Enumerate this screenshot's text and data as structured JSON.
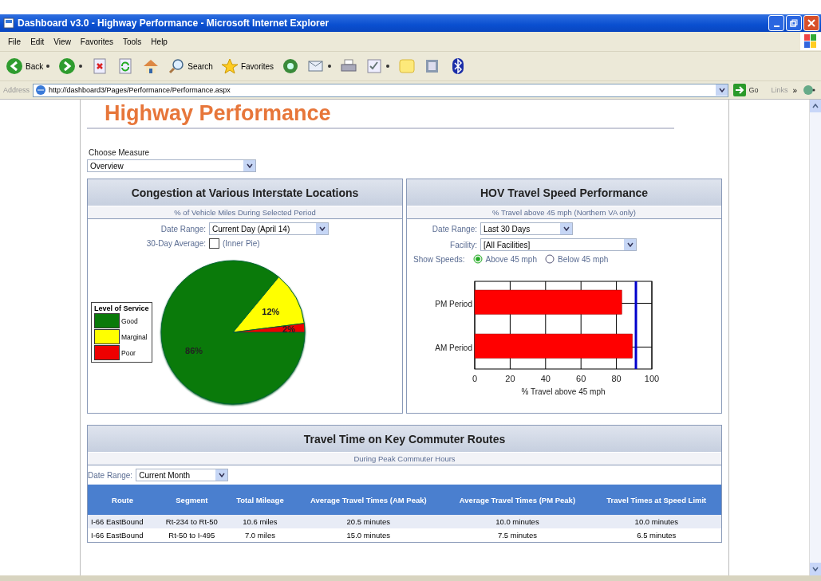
{
  "window": {
    "title": "Dashboard v3.0 - Highway Performance - Microsoft Internet Explorer"
  },
  "menu": [
    "File",
    "Edit",
    "View",
    "Favorites",
    "Tools",
    "Help"
  ],
  "toolbar": [
    {
      "kind": "back",
      "label": "Back",
      "dropdown": true
    },
    {
      "kind": "forward",
      "dropdown": true
    },
    {
      "kind": "stop",
      "dropdown": false
    },
    {
      "kind": "refresh",
      "dropdown": false
    },
    {
      "kind": "home",
      "dropdown": false
    },
    {
      "kind": "search",
      "label": "Search",
      "dropdown": false
    },
    {
      "kind": "favorites",
      "label": "Favorites",
      "dropdown": false
    },
    {
      "kind": "media",
      "dropdown": false
    },
    {
      "kind": "mail",
      "dropdown": true
    },
    {
      "kind": "print",
      "dropdown": false
    },
    {
      "kind": "edit",
      "dropdown": true
    },
    {
      "kind": "notes",
      "dropdown": false
    },
    {
      "kind": "research",
      "dropdown": false
    },
    {
      "kind": "bluetooth",
      "dropdown": false
    }
  ],
  "address": {
    "label": "Address",
    "url": "http://dashboard3/Pages/Performance/Performance.aspx",
    "go": "Go",
    "links": "Links",
    "more": "»"
  },
  "page": {
    "heading": "Highway Performance",
    "measure_label": "Choose Measure",
    "measure_value": "Overview"
  },
  "congestion": {
    "title": "Congestion at Various Interstate Locations",
    "subtitle": "% of Vehicle Miles During Selected Period",
    "date_label": "Date Range:",
    "date_value": "Current Day (April 14)",
    "avg_label": "30-Day Average:",
    "avg_checked": false,
    "avg_text": "(Inner Pie)",
    "legend_title": "Level of Service",
    "legend": [
      {
        "color": "#0a7a0a"
      },
      {
        "color": "#ffff00"
      },
      {
        "color": "#ee0000"
      }
    ],
    "chart_data": {
      "type": "pie",
      "categories": [
        "Good",
        "Marginal",
        "Poor"
      ],
      "values": [
        86,
        12,
        2
      ],
      "value_labels": [
        "86%",
        "12%",
        "2%"
      ]
    }
  },
  "hov": {
    "title": "HOV Travel Speed Performance",
    "subtitle": "% Travel above 45 mph (Northern VA only)",
    "date_label": "Date Range:",
    "date_value": "Last 30 Days",
    "facility_label": "Facility:",
    "facility_value": "[All Facilities]",
    "speeds_label": "Show Speeds:",
    "speed_options": [
      {
        "label": "Above 45 mph",
        "selected": true
      },
      {
        "label": "Below 45 mph",
        "selected": false
      }
    ],
    "chart_data": {
      "type": "bar",
      "orientation": "horizontal",
      "grid": true,
      "categories": [
        "PM Period",
        "AM Period"
      ],
      "series": [
        {
          "color": "#ff0000",
          "values": [
            83,
            89
          ]
        }
      ],
      "xlim": [
        0,
        100
      ],
      "xticks": [
        0,
        20,
        40,
        60,
        80,
        100
      ],
      "xlabel": "% Travel above 45 mph",
      "ref_lines": [
        {
          "axis": "x",
          "value": 91,
          "color": "#0000cc"
        }
      ]
    }
  },
  "travel": {
    "title": "Travel Time on Key Commuter Routes",
    "subtitle": "During Peak Commuter Hours",
    "date_label": "Date Range:",
    "date_value": "Current Month",
    "columns": [
      "Route",
      "Segment",
      "Total Mileage",
      "Average Travel Times (AM Peak)",
      "Average Travel Times (PM Peak)",
      "Travel Times at Speed Limit"
    ],
    "rows": [
      [
        "I-66 EastBound",
        "Rt-234 to Rt-50",
        "10.6 miles",
        "20.5 minutes",
        "10.0 minutes",
        "10.0 minutes"
      ],
      [
        "I-66 EastBound",
        "Rt-50 to I-495",
        "7.0 miles",
        "15.0 minutes",
        "7.5 minutes",
        "6.5 minutes"
      ]
    ]
  }
}
